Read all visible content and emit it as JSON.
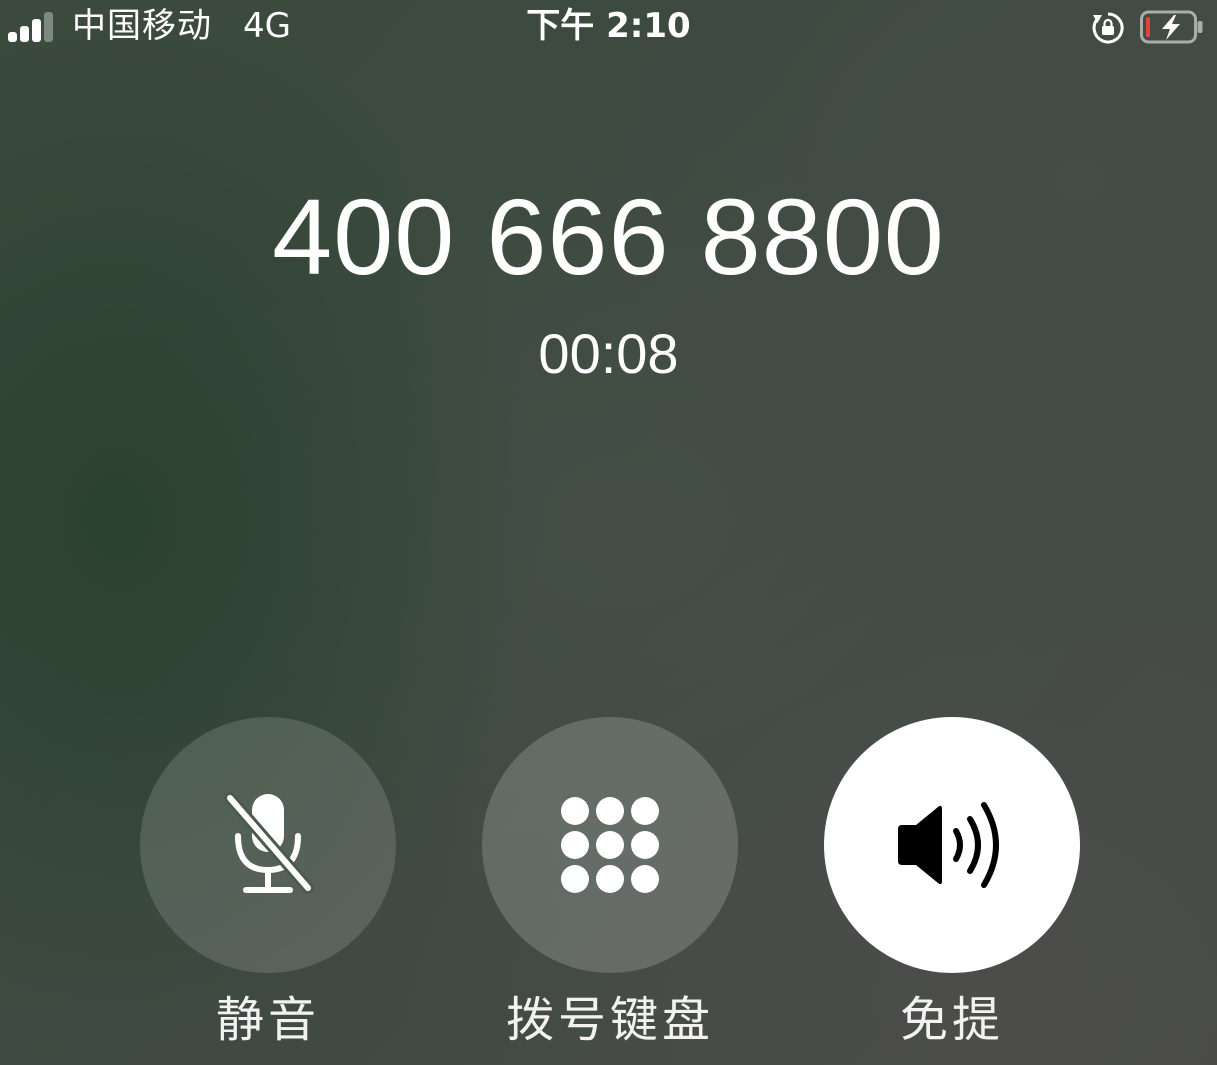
{
  "status_bar": {
    "carrier": "中国移动",
    "network": "4G",
    "time": "下午 2:10",
    "signal_bars": 3,
    "signal_bars_total": 4,
    "icons": [
      "signal-icon",
      "orientation-lock-icon",
      "battery-charging-icon"
    ],
    "battery_low_color": "#e8413a"
  },
  "call": {
    "number": "400 666 8800",
    "duration": "00:08"
  },
  "actions": {
    "mute": {
      "label": "静音",
      "icon": "mic-slash-icon"
    },
    "keypad": {
      "label": "拨号键盘",
      "icon": "keypad-icon"
    },
    "speaker": {
      "label": "免提",
      "icon": "speaker-icon",
      "active": true
    }
  }
}
